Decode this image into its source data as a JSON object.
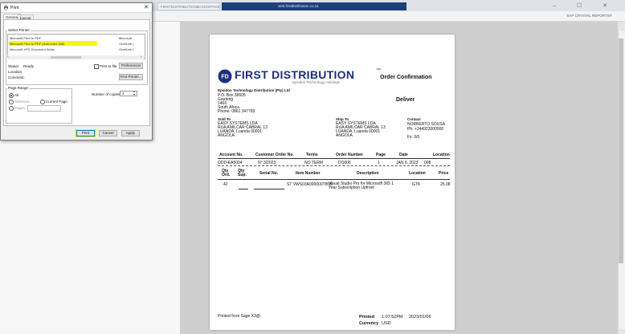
{
  "browser": {
    "tab1_title": "FIRSTDISTRIBUTIONBACKOFFICE CRYST",
    "tab2_title": "web.firstdistribution.co.za",
    "window_controls": "– ☐ ✕",
    "report_label": "SAP CRYSTAL REPORTS®"
  },
  "dialog": {
    "title": "Print",
    "tabs": [
      "General",
      "Layout"
    ],
    "select_printer_label": "Select Printer",
    "printers_left": [
      "Microsoft Print to PDF",
      "Microsoft Print to PDF (redirected 468)",
      "Microsoft XPS Document Writer"
    ],
    "printers_right": [
      "Microsoft",
      "OneNote (",
      "OneNote f"
    ],
    "status_label": "Status:",
    "status_value": "Ready",
    "location_label": "Location:",
    "comment_label": "Comment:",
    "print_to_file_label": "Print to file",
    "preferences_label": "Preferences",
    "find_printer_label": "Find Printer...",
    "page_range_label": "Page Range",
    "all_label": "All",
    "selection_label": "Selection",
    "current_page_label": "Current Page",
    "pages_label": "Pages:",
    "copies_label": "Number of copies:",
    "copies_value": "1",
    "print_button": "Print",
    "cancel_button": "Cancel",
    "apply_button": "Apply"
  },
  "report": {
    "brand": "FIRST DISTRIBUTION",
    "brand_tm": "™",
    "brand_sub": "Epsidon Technology Holdings",
    "doc_title": "Order Confirmation",
    "company_name": "Epsidon Technology Distribution (Pty) Ltd",
    "address_lines": [
      "P.O. Box 38605",
      "Gauteng",
      "1466",
      "South Africa",
      "Phone: 0861 347783"
    ],
    "deliver_label": "Deliver",
    "sold_to_label": "Sold To",
    "sold_to_lines": [
      "EASY SYSTEMS LDA",
      "RUA AMILCAR CABRAL 13",
      "LUANDA, Luanda 00001",
      "ANGOLA"
    ],
    "ship_to_label": "Ship To",
    "ship_to_lines": [
      "EASY SYSTEMS LDA",
      "RUA AMILCAR CABRAL 13",
      "LUANDA, Luanda 00001",
      "ANGOLA"
    ],
    "contact_label": "Contact",
    "contact_lines": [
      "NORBERTO SOUSA",
      "Ph: +244923000000",
      "Fx: 0/0"
    ],
    "order_headers": [
      "Account No.",
      "Customer Order No.",
      "Terms",
      "Order Number",
      "Page",
      "Date",
      "Location"
    ],
    "order_values": [
      "ODD-EA5004",
      "N° 3/2023",
      "NO TERM",
      "DO006",
      "1",
      "JAN 6, 2023",
      "008"
    ],
    "line_headers": [
      "Qty Ord.",
      "Qty Sup.",
      "Serial No.",
      "Item Number",
      "Description",
      "Location",
      "Price"
    ],
    "line_values": [
      "42",
      "",
      "",
      "ST VWS03A000000TBV0",
      "Visual Studio Pro for Microsoft 365 1 Year Subscription Upfront",
      "GTK",
      "25.08"
    ],
    "footer_left": "Printed from Sage X3@",
    "printed_label": "Printed",
    "printed_time": "1:07:52PM",
    "printed_date": "2023/01/06",
    "currency_label": "Currency",
    "currency_value": "USD"
  },
  "colors": {
    "highlight": "#f4f41e",
    "brand_blue": "#1c2f7a",
    "tab_active": "#1f3f7a"
  }
}
